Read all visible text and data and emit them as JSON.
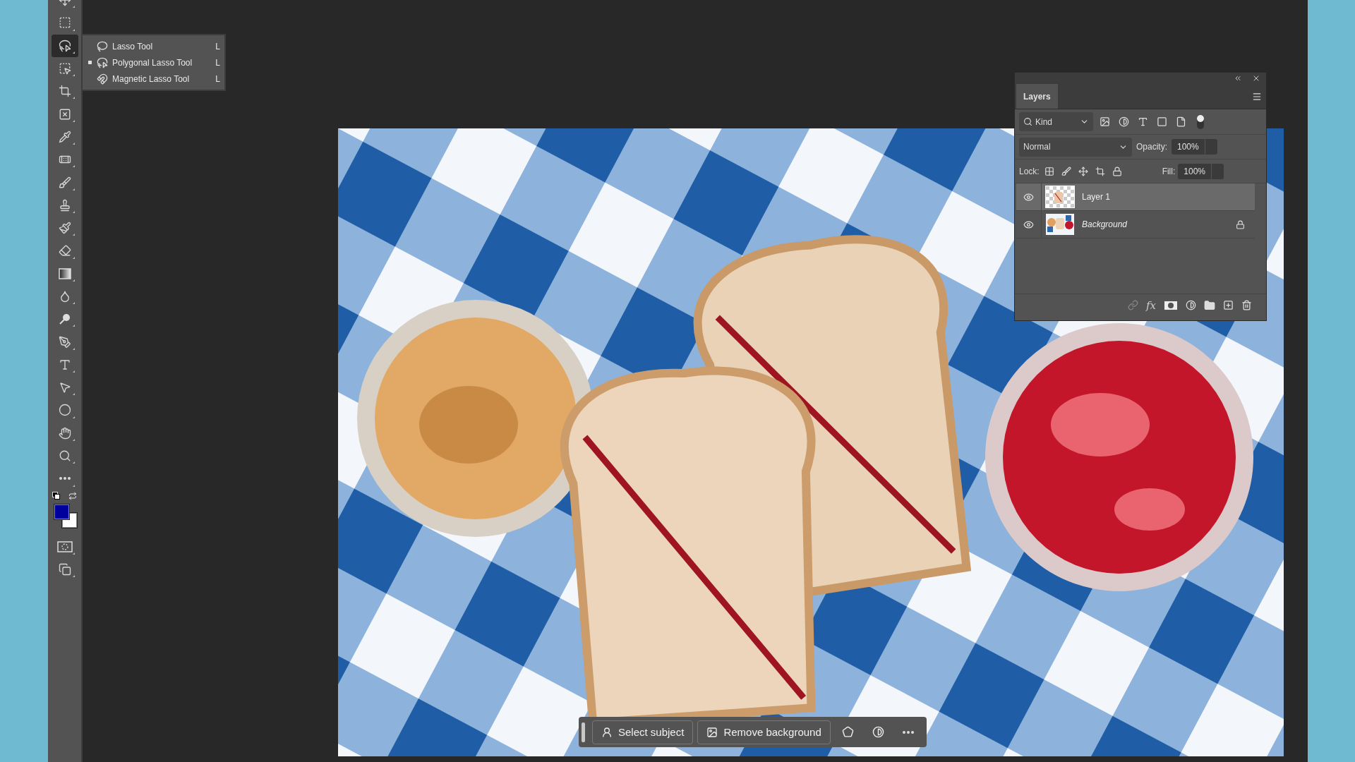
{
  "toolbar": {
    "tools": [
      {
        "kind": "move",
        "selected": false
      },
      {
        "kind": "marquee",
        "selected": false
      },
      {
        "kind": "lasso",
        "selected": true
      },
      {
        "kind": "object",
        "selected": false
      },
      {
        "kind": "crop",
        "selected": false
      },
      {
        "kind": "frame",
        "selected": false
      },
      {
        "kind": "eyedropper",
        "selected": false
      },
      {
        "kind": "healing",
        "selected": false
      },
      {
        "kind": "brush",
        "selected": false
      },
      {
        "kind": "stamp",
        "selected": false
      },
      {
        "kind": "history",
        "selected": false
      },
      {
        "kind": "eraser",
        "selected": false
      },
      {
        "kind": "gradient",
        "selected": false
      },
      {
        "kind": "blur",
        "selected": false
      },
      {
        "kind": "dodge",
        "selected": false
      },
      {
        "kind": "pen",
        "selected": false
      },
      {
        "kind": "type",
        "selected": false
      },
      {
        "kind": "path",
        "selected": false
      },
      {
        "kind": "ellipse",
        "selected": false
      },
      {
        "kind": "hand",
        "selected": false
      },
      {
        "kind": "zoom",
        "selected": false
      },
      {
        "kind": "more",
        "selected": false
      }
    ]
  },
  "tool_flyout": {
    "items": [
      {
        "kind": "lasso",
        "label": "Lasso Tool",
        "shortcut": "L",
        "selected": false
      },
      {
        "kind": "polygonal",
        "label": "Polygonal Lasso Tool",
        "shortcut": "L",
        "selected": true
      },
      {
        "kind": "magnetic",
        "label": "Magnetic Lasso Tool",
        "shortcut": "L",
        "selected": false
      }
    ]
  },
  "layers_panel": {
    "title": "Layers",
    "filter": "Kind",
    "blend_mode": "Normal",
    "opacity_label": "Opacity:",
    "opacity": "100%",
    "lock_label": "Lock:",
    "fill_label": "Fill:",
    "fill": "100%",
    "fx_label": "fx",
    "layers": [
      {
        "name": "Layer 1",
        "kind": "layer",
        "selected": true,
        "visible": true,
        "locked": false
      },
      {
        "name": "Background",
        "kind": "background",
        "selected": false,
        "visible": true,
        "locked": true
      }
    ]
  },
  "contextual_bar": {
    "buttons": [
      {
        "kind": "subject",
        "label": "Select subject"
      },
      {
        "kind": "remove",
        "label": "Remove background"
      }
    ]
  }
}
